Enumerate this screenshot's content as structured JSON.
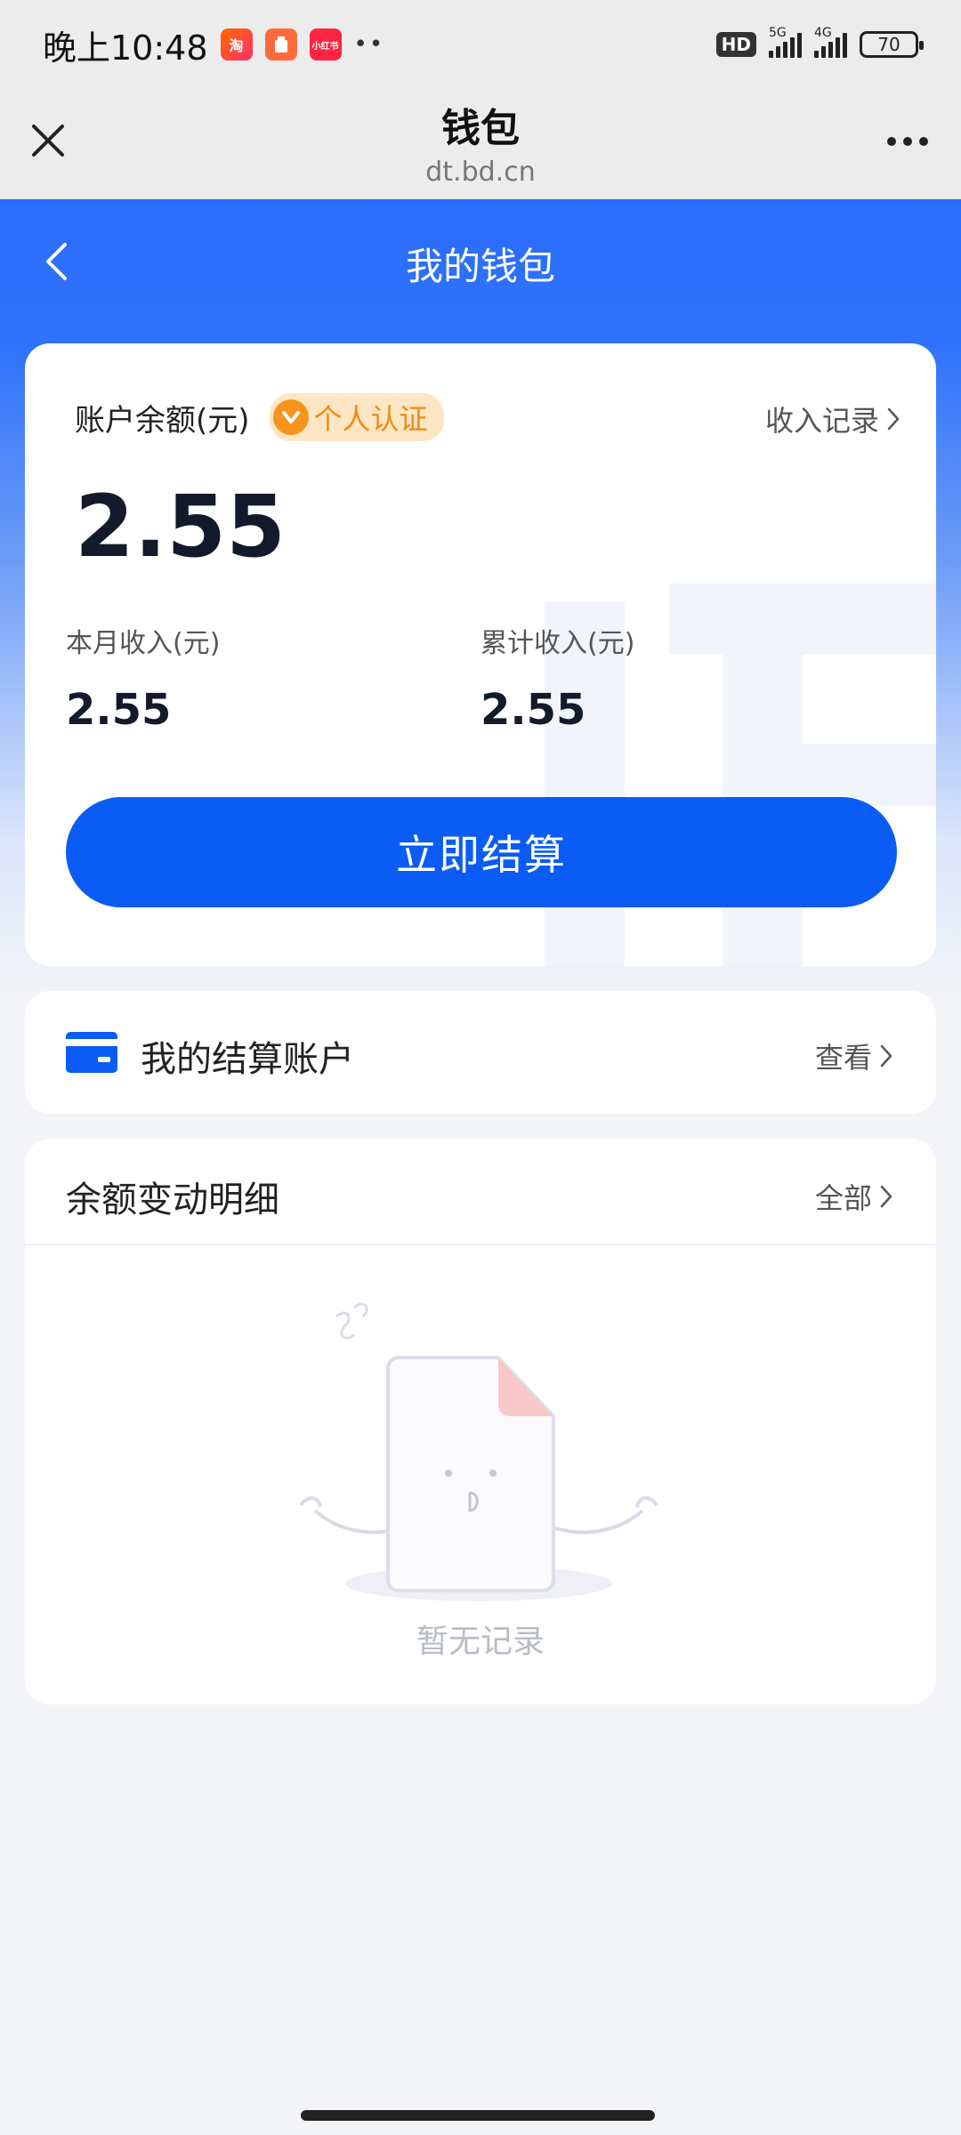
{
  "status_bar": {
    "time": "晚上10:48",
    "app_badges": [
      "淘",
      "",
      "小红书"
    ],
    "dots": "••",
    "hd": "HD",
    "network_1": "5G",
    "network_2": "4G",
    "battery": "70"
  },
  "web_titlebar": {
    "title": "钱包",
    "url": "dt.bd.cn"
  },
  "page": {
    "title": "我的钱包"
  },
  "balance_card": {
    "label": "账户余额(元)",
    "verify_badge": "个人认证",
    "income_record_link": "收入记录",
    "balance": "2.55",
    "month_income_label": "本月收入(元)",
    "month_income_value": "2.55",
    "total_income_label": "累计收入(元)",
    "total_income_value": "2.55",
    "settle_button": "立即结算"
  },
  "account_card": {
    "title": "我的结算账户",
    "view_link": "查看"
  },
  "detail_card": {
    "title": "余额变动明细",
    "all_link": "全部",
    "empty_text": "暂无记录"
  },
  "colors": {
    "primary_blue": "#0b5cf5",
    "header_blue": "#2a6dfb",
    "badge_orange": "#f7941d"
  }
}
